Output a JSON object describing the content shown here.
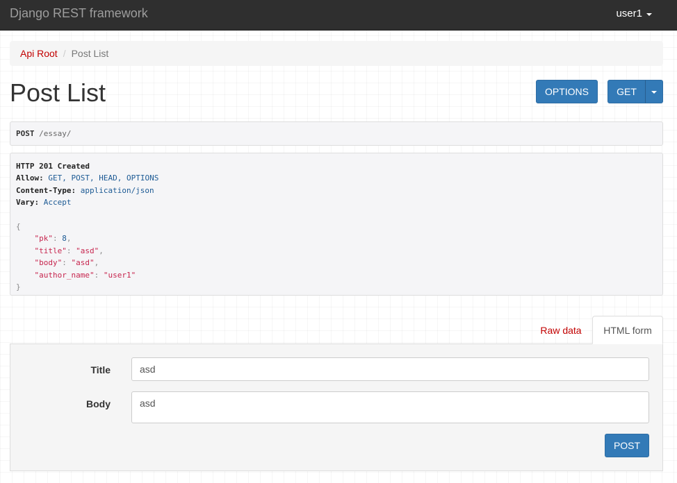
{
  "navbar": {
    "brand": "Django REST framework",
    "user": "user1"
  },
  "breadcrumb": {
    "items": [
      "Api Root",
      "Post List"
    ],
    "separator": "/"
  },
  "page": {
    "title": "Post List"
  },
  "toolbar": {
    "options_label": "OPTIONS",
    "get_label": "GET"
  },
  "request": {
    "method": "POST",
    "path": " /essay/"
  },
  "response": {
    "status": "HTTP 201 Created",
    "headers": [
      {
        "name": "Allow:",
        "value": " GET, POST, HEAD, OPTIONS"
      },
      {
        "name": "Content-Type:",
        "value": " application/json"
      },
      {
        "name": "Vary:",
        "value": " Accept"
      }
    ],
    "body": {
      "open": "{",
      "close": "}",
      "fields": [
        {
          "key": "\"pk\"",
          "value": "8",
          "trail": ","
        },
        {
          "key": "\"title\"",
          "value": "\"asd\"",
          "trail": ","
        },
        {
          "key": "\"body\"",
          "value": "\"asd\"",
          "trail": ","
        },
        {
          "key": "\"author_name\"",
          "value": "\"user1\"",
          "trail": ""
        }
      ]
    }
  },
  "tabs": {
    "raw": "Raw data",
    "html": "HTML form"
  },
  "form": {
    "title_label": "Title",
    "title_value": "asd",
    "body_label": "Body",
    "body_value": "asd",
    "submit_label": "POST"
  },
  "colors": {
    "navbar": "#2f2f2f",
    "link": "#c20000",
    "primary": "#337ab7"
  }
}
